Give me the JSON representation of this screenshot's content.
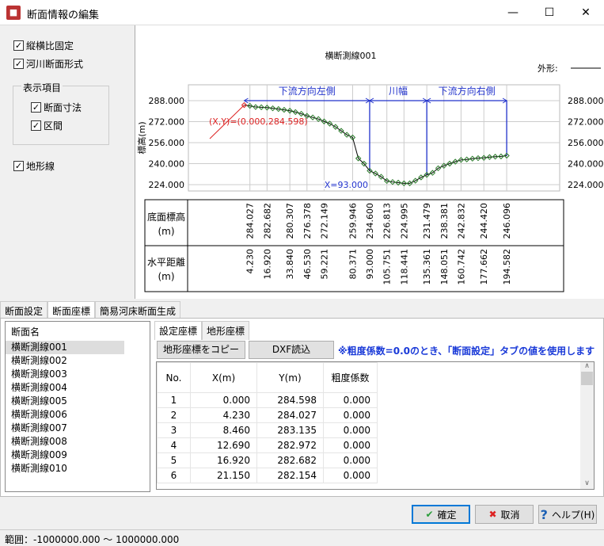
{
  "window": {
    "title": "断面情報の編集",
    "min": "—",
    "max": "☐",
    "close": "✕"
  },
  "left": {
    "aspect_fixed": "縦横比固定",
    "river_section": "河川断面形式",
    "display_group": "表示項目",
    "section_dims": "断面寸法",
    "interval": "区間",
    "terrain_line": "地形線"
  },
  "chart_data": {
    "type": "line",
    "title": "横断測線001",
    "legend": "外形:",
    "ylabel": "標高(m)",
    "ylim": [
      224,
      288
    ],
    "yticks": [
      "288.000",
      "272.000",
      "256.000",
      "240.000",
      "224.000"
    ],
    "ytick_values": [
      288,
      272,
      256,
      240,
      224
    ],
    "annotation_point": "(X,Y)=(0.000,284.598)",
    "annotation_x": "X=93.000",
    "spans": [
      {
        "label": "下流方向左側",
        "from": 0,
        "to": 93
      },
      {
        "label": "川幅",
        "from": 93,
        "to": 135.361
      },
      {
        "label": "下流方向右側",
        "from": 135.361,
        "to": 194.582
      }
    ],
    "x": [
      0,
      4.23,
      8.46,
      12.69,
      16.92,
      21.15,
      25.4,
      29.6,
      33.84,
      38,
      42.3,
      46.53,
      50.8,
      55,
      59.221,
      63.4,
      67.7,
      71.9,
      76.1,
      80.371,
      84.6,
      88.8,
      93,
      97.3,
      101.5,
      105.751,
      110,
      114.2,
      118.441,
      122.7,
      126.9,
      131.1,
      135.361,
      139.6,
      143.8,
      148.051,
      152.3,
      156.5,
      160.742,
      165,
      169.2,
      173.4,
      177.662,
      181.9,
      186.1,
      190.4,
      194.582
    ],
    "y": [
      284.598,
      284.027,
      283.135,
      282.972,
      282.682,
      282.154,
      281.6,
      281.0,
      280.307,
      279.3,
      278,
      276.378,
      275.2,
      274.0,
      272.149,
      270.5,
      268,
      265,
      262,
      259.946,
      244,
      240,
      234.6,
      232.5,
      230,
      226.813,
      226,
      225.5,
      224.995,
      225,
      227,
      229.5,
      231.479,
      233,
      236.5,
      238.381,
      240,
      241.5,
      242.832,
      243.2,
      243.8,
      244.2,
      244.42,
      245,
      245.3,
      245.5,
      246.096
    ]
  },
  "table": {
    "row1_label": "底面標高",
    "row2_label": "水平距離",
    "unit": "(m)",
    "elevations": [
      "284.027",
      "282.682",
      "280.307",
      "276.378",
      "272.149",
      "259.946",
      "234.600",
      "226.813",
      "224.995",
      "231.479",
      "238.381",
      "242.832",
      "244.420",
      "246.096"
    ],
    "distances": [
      "4.230",
      "16.920",
      "33.840",
      "46.530",
      "59.221",
      "80.371",
      "93.000",
      "105.751",
      "118.441",
      "135.361",
      "148.051",
      "160.742",
      "177.662",
      "194.582"
    ],
    "x_values": [
      4.23,
      16.92,
      33.84,
      46.53,
      59.221,
      80.371,
      93,
      105.751,
      118.441,
      135.361,
      148.051,
      160.742,
      177.662,
      194.582
    ]
  },
  "tabs": [
    "断面設定",
    "断面座標",
    "簡易河床断面生成"
  ],
  "section_list": {
    "header": "断面名",
    "items": [
      "横断測線001",
      "横断測線002",
      "横断測線003",
      "横断測線004",
      "横断測線005",
      "横断測線006",
      "横断測線007",
      "横断測線008",
      "横断測線009",
      "横断測線010"
    ]
  },
  "subtabs": [
    "設定座標",
    "地形座標"
  ],
  "copy_button": "地形座標をコピー",
  "dxf_button": "DXF読込",
  "note": "※粗度係数=0.0のとき、「断面設定」タブの値を使用します",
  "coords": {
    "headers": [
      "No.",
      "X(m)",
      "Y(m)",
      "粗度係数"
    ],
    "rows": [
      [
        "1",
        "0.000",
        "284.598",
        "0.000"
      ],
      [
        "2",
        "4.230",
        "284.027",
        "0.000"
      ],
      [
        "3",
        "8.460",
        "283.135",
        "0.000"
      ],
      [
        "4",
        "12.690",
        "282.972",
        "0.000"
      ],
      [
        "5",
        "16.920",
        "282.682",
        "0.000"
      ],
      [
        "6",
        "21.150",
        "282.154",
        "0.000"
      ]
    ]
  },
  "buttons": {
    "ok": "確定",
    "cancel": "取消",
    "help": "ヘルプ(H)"
  },
  "status": "範囲：-1000000.000 〜 1000000.000"
}
